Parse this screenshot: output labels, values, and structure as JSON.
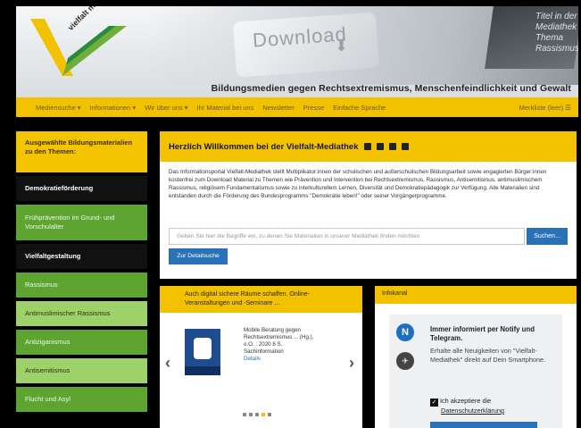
{
  "header": {
    "logo_text": "vielfalt mediathek",
    "banner_word": "Download",
    "paper_text": "Titel in der Mediathek Thema Rassismus",
    "tagline": "Bildungsmedien gegen Rechtsextremismus, Menschenfeindlichkeit und Gewalt"
  },
  "nav": {
    "items": [
      {
        "label": "Mediensuche ▾"
      },
      {
        "label": "Informationen ▾"
      },
      {
        "label": "Wir über uns ▾"
      },
      {
        "label": "Ihr Material bei uns"
      },
      {
        "label": "Newsletter"
      },
      {
        "label": "Presse"
      },
      {
        "label": "Einfache Sprache"
      }
    ],
    "watchlist": "Merkliste (leer) ☰"
  },
  "sidebar": {
    "heading": "Ausgewählte Bildungsmaterialien zu den Themen:",
    "items": [
      {
        "label": "Demokratieförderung"
      },
      {
        "label": "Frühprävention im Grund- und Vorschulalter"
      },
      {
        "label": "Vielfaltgestaltung"
      },
      {
        "label": "Rassismus"
      },
      {
        "label": "Antimuslimischer Rassismus"
      },
      {
        "label": "Antiziganismus"
      },
      {
        "label": "Antisemitismus"
      },
      {
        "label": "Flucht und Asyl"
      }
    ]
  },
  "welcome": {
    "title": "Herzlich Willkommen bei der Vielfalt-Mediathek",
    "social_icons": [
      "facebook-icon",
      "twitter-icon",
      "rss-icon",
      "email-icon"
    ],
    "intro": "Das Informationsportal Vielfalt-Mediathek stellt Multiplikator:innen der schulischen und außerschulischen Bildungsarbeit sowie engagierten Bürger:innen kostenfrei zum Download Material zu Themen wie Prävention und Intervention bei Rechtsextremismus, Rassismus, Antisemitismus, antimuslimischem Rassismus, religiösem Fundamentalismus sowie zu interkulturellem Lernen, Diversität und Demokratiepädagogik zur Verfügung. Alle Materialien sind entstanden durch die Förderung des Bundesprogramms \"Demokratie leben!\" oder seiner Vorgängerprogramme.",
    "search_placeholder": "Geben Sie hier die Begriffe ein, zu denen Sie Materialien in unserer Mediathek finden möchten",
    "search_button": "Suchen...",
    "detail_button": "Zur Detailsuche"
  },
  "carousel": {
    "heading": "Auch digital sichere Räume schaffen. Online-Veranstaltungen und -Seminare ...",
    "title_line": "Mobile Beratung gegen Rechtsextremismus ... (Hg.),",
    "info_line": "o.O. : 2020 8 S.",
    "type_line": "Sachinformation",
    "details_link": "Details",
    "prev_icon": "‹",
    "next_icon": "›",
    "dots": [
      false,
      false,
      false,
      true,
      false
    ]
  },
  "infokanal": {
    "heading": "Infokanal",
    "title": "Immer informiert per Notify und Telegram.",
    "subtitle": "Erhalte alle Neuigkeiten von \"Vielfalt-Mediathek\" direkt auf Dein Smartphone.",
    "consent": "Ich akzeptiere die",
    "privacy_link": "Datenschutzerklärung",
    "notify_letter": "N",
    "telegram_glyph": "✈"
  }
}
